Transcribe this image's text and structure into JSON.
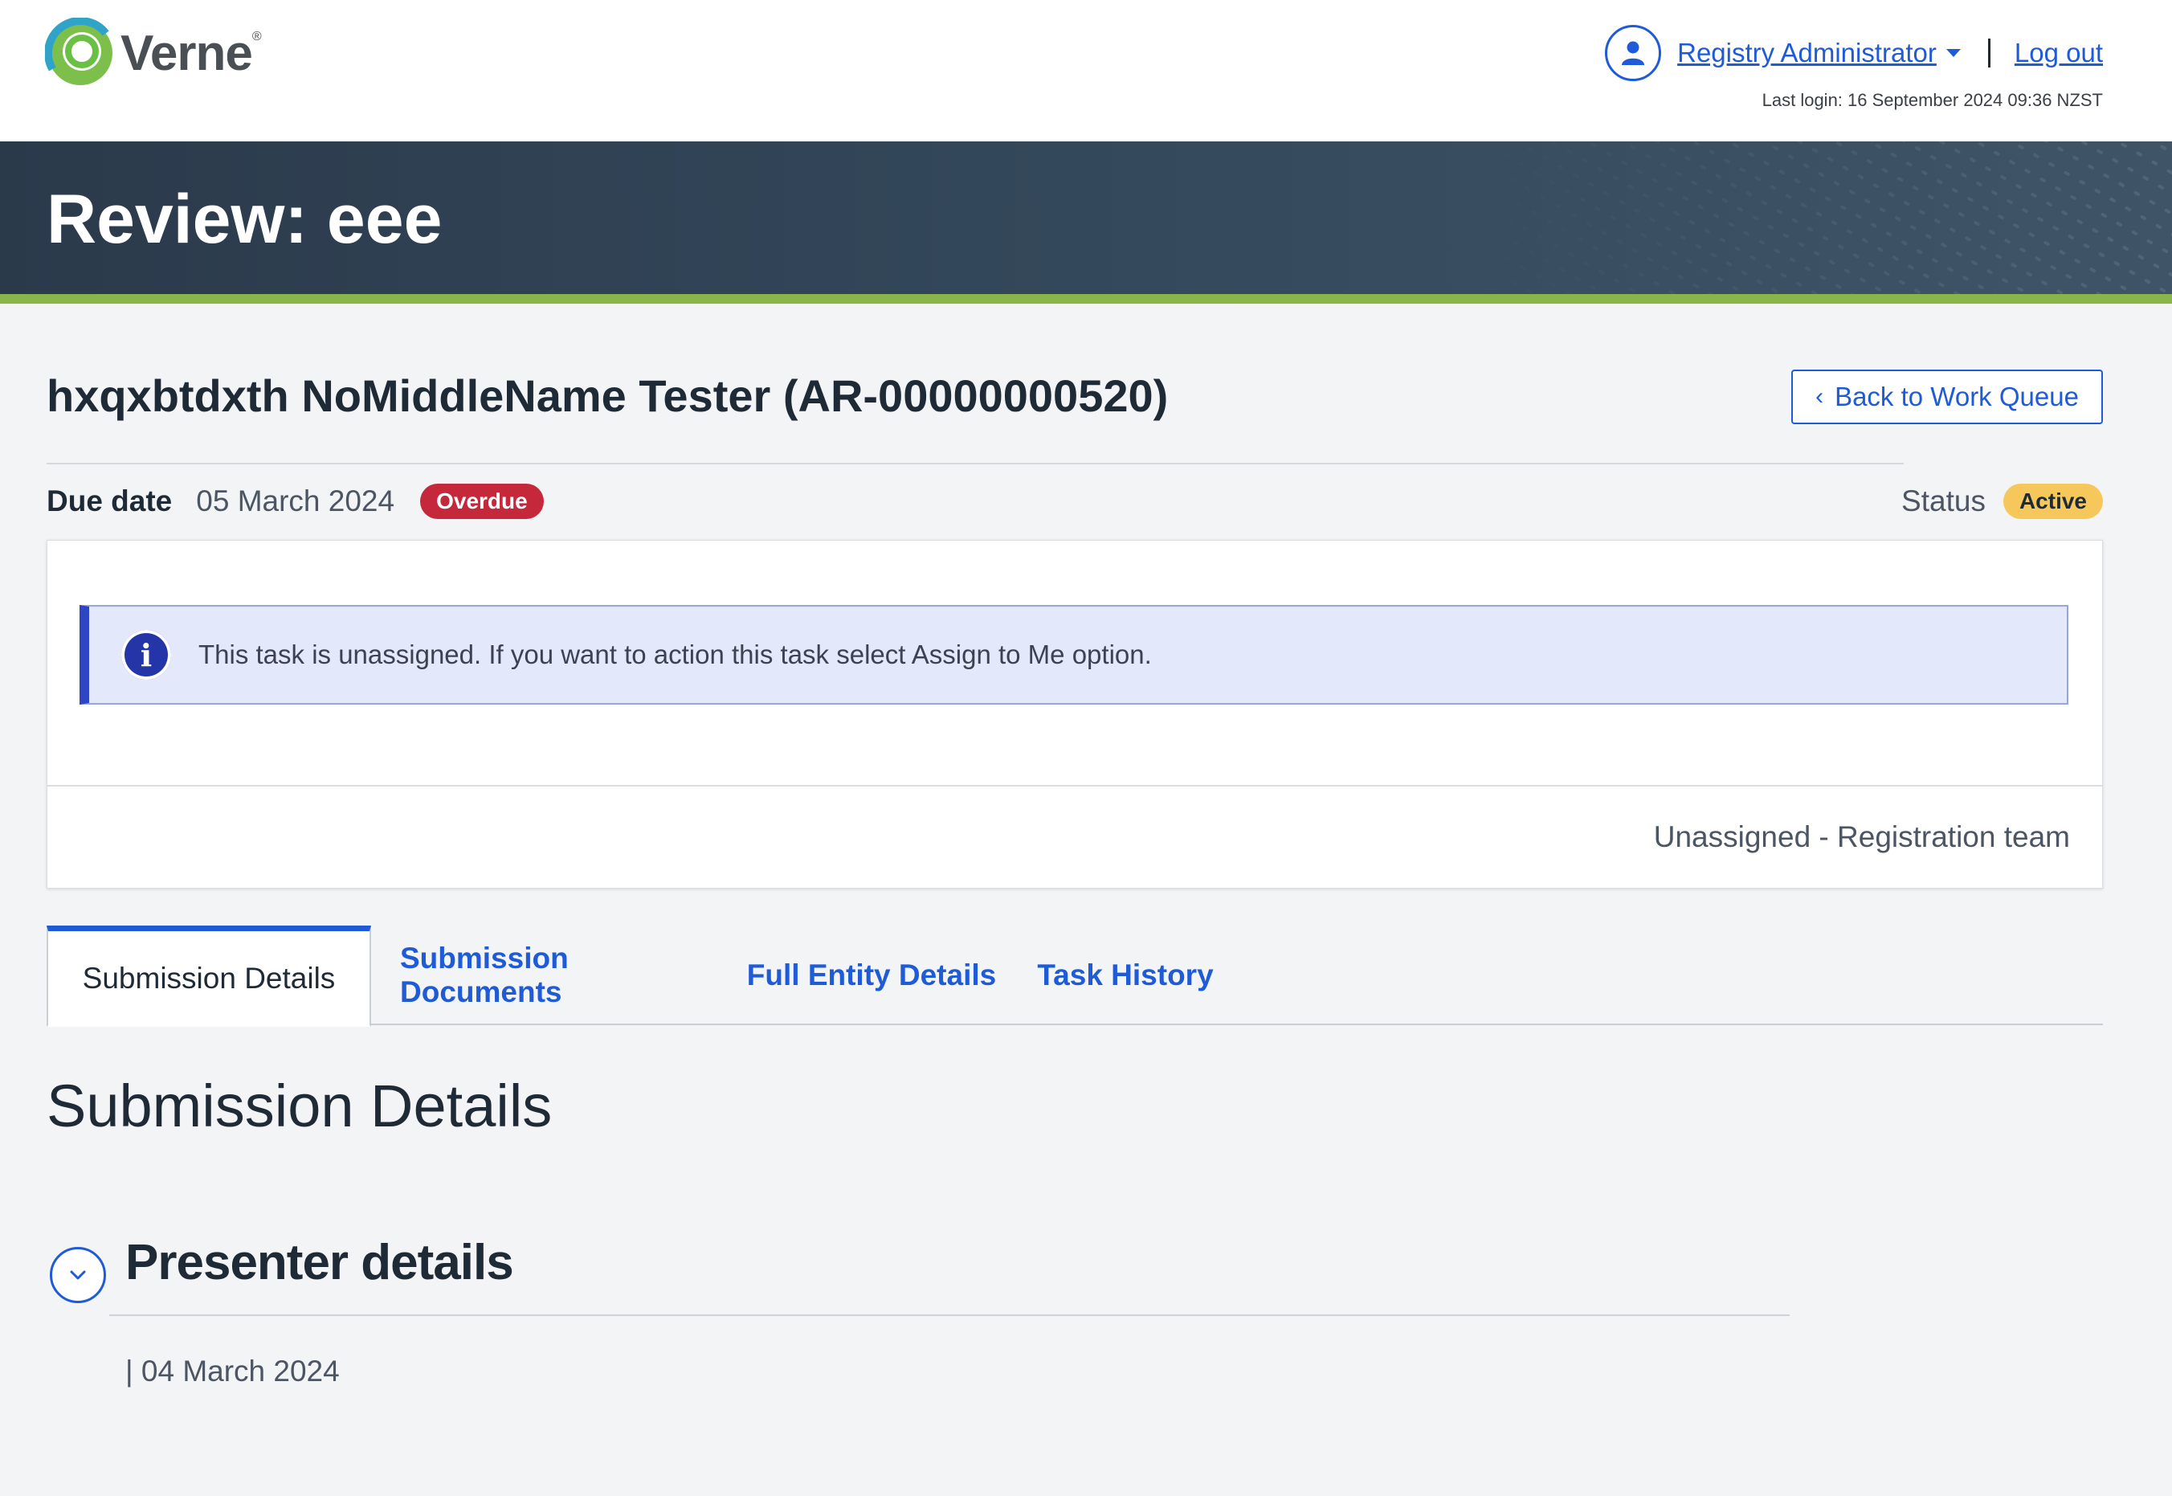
{
  "header": {
    "logo_text": "Verne",
    "logo_mark": "®",
    "user_name": "Registry Administrator",
    "logout_label": "Log out",
    "last_login": "Last login: 16 September 2024 09:36 NZST"
  },
  "banner": {
    "title": "Review: eee"
  },
  "record": {
    "title": "hxqxbtdxth NoMiddleName Tester (AR-00000000520)",
    "back_label": "Back to Work Queue",
    "due_label": "Due date",
    "due_value": "05 March 2024",
    "overdue_badge": "Overdue",
    "status_label": "Status",
    "status_value": "Active"
  },
  "task_card": {
    "alert_text": "This task is unassigned. If you want to action this task select Assign to Me option.",
    "assignee": "Unassigned - Registration team"
  },
  "tabs": [
    {
      "label": "Submission Details",
      "active": true
    },
    {
      "label": "Submission Documents",
      "active": false
    },
    {
      "label": "Full Entity Details",
      "active": false
    },
    {
      "label": "Task History",
      "active": false
    }
  ],
  "section": {
    "title": "Submission Details",
    "presenter_title": "Presenter details",
    "presenter_date": "| 04 March 2024"
  },
  "colors": {
    "link_blue": "#1f5bd6",
    "banner_dark": "#2b3a4b",
    "accent_green": "#8ab54a",
    "overdue_red": "#c4283a",
    "active_yellow": "#f6c75b",
    "info_bg": "#e4e8fb"
  },
  "icons": {
    "user": "user-icon",
    "dropdown": "chevron-down-icon",
    "back": "chevron-left-icon",
    "info": "info-icon",
    "collapse": "chevron-down-icon"
  }
}
